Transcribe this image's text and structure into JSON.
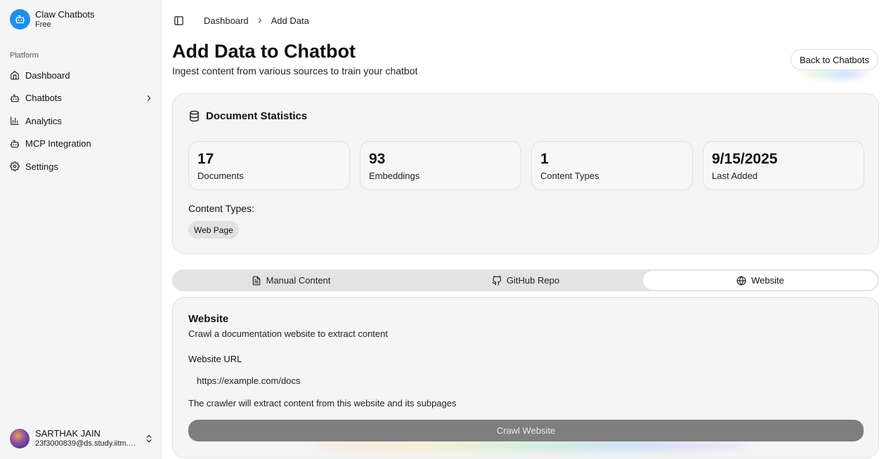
{
  "brand": {
    "name": "Claw Chatbots",
    "plan": "Free"
  },
  "sidebar": {
    "section_label": "Platform",
    "items": [
      {
        "label": "Dashboard",
        "icon": "home-icon"
      },
      {
        "label": "Chatbots",
        "icon": "bot-icon"
      },
      {
        "label": "Analytics",
        "icon": "bar-chart-icon"
      },
      {
        "label": "MCP Integration",
        "icon": "bot-icon"
      },
      {
        "label": "Settings",
        "icon": "gear-icon"
      }
    ]
  },
  "user": {
    "name": "SARTHAK JAIN",
    "email": "23f3000839@ds.study.iitm.ac.in"
  },
  "breadcrumb": {
    "items": [
      "Dashboard",
      "Add Data"
    ]
  },
  "header": {
    "title": "Add Data to Chatbot",
    "subtitle": "Ingest content from various sources to train your chatbot",
    "back_label": "Back to Chatbots"
  },
  "stats": {
    "title": "Document Statistics",
    "items": [
      {
        "value": "17",
        "label": "Documents"
      },
      {
        "value": "93",
        "label": "Embeddings"
      },
      {
        "value": "1",
        "label": "Content Types"
      },
      {
        "value": "9/15/2025",
        "label": "Last Added"
      }
    ],
    "content_types_label": "Content Types:",
    "content_types": [
      "Web Page"
    ]
  },
  "tabs": [
    {
      "label": "Manual Content",
      "icon": "document-icon",
      "active": false
    },
    {
      "label": "GitHub Repo",
      "icon": "github-icon",
      "active": false
    },
    {
      "label": "Website",
      "icon": "globe-icon",
      "active": true
    }
  ],
  "website": {
    "title": "Website",
    "description": "Crawl a documentation website to extract content",
    "url_label": "Website URL",
    "url_placeholder": "https://example.com/docs",
    "hint": "The crawler will extract content from this website and its subpages",
    "button_label": "Crawl Website"
  },
  "colors": {
    "brand": "#1e8fe8",
    "button_disabled": "#7f7f7f"
  }
}
